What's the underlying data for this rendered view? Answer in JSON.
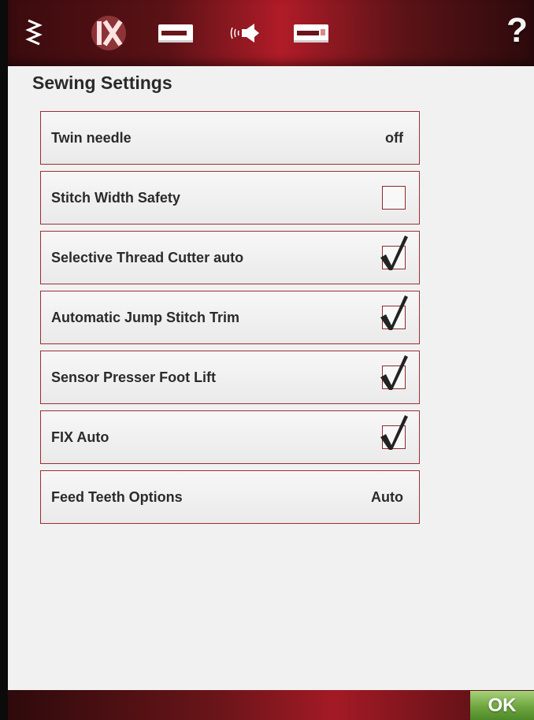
{
  "header": {
    "tabs": [
      {
        "icon": "stitch-zigzag-icon"
      },
      {
        "icon": "fix-icon"
      },
      {
        "icon": "sewing-machine-icon"
      },
      {
        "icon": "sound-icon"
      },
      {
        "icon": "sewing-machine-settings-icon"
      }
    ],
    "help_label": "?"
  },
  "page": {
    "title": "Sewing Settings"
  },
  "settings": [
    {
      "label": "Twin needle",
      "type": "value",
      "value": "off"
    },
    {
      "label": "Stitch Width Safety",
      "type": "checkbox",
      "checked": false
    },
    {
      "label": "Selective Thread Cutter auto",
      "type": "checkbox",
      "checked": true
    },
    {
      "label": "Automatic Jump Stitch Trim",
      "type": "checkbox",
      "checked": true
    },
    {
      "label": "Sensor Presser Foot Lift",
      "type": "checkbox",
      "checked": true
    },
    {
      "label": "FIX Auto",
      "type": "checkbox",
      "checked": true
    },
    {
      "label": "Feed Teeth Options",
      "type": "value",
      "value": "Auto"
    }
  ],
  "footer": {
    "ok_label": "OK"
  },
  "colors": {
    "accent": "#b01c28",
    "border": "#9a2f33",
    "ok_green": "#6ea53f"
  }
}
